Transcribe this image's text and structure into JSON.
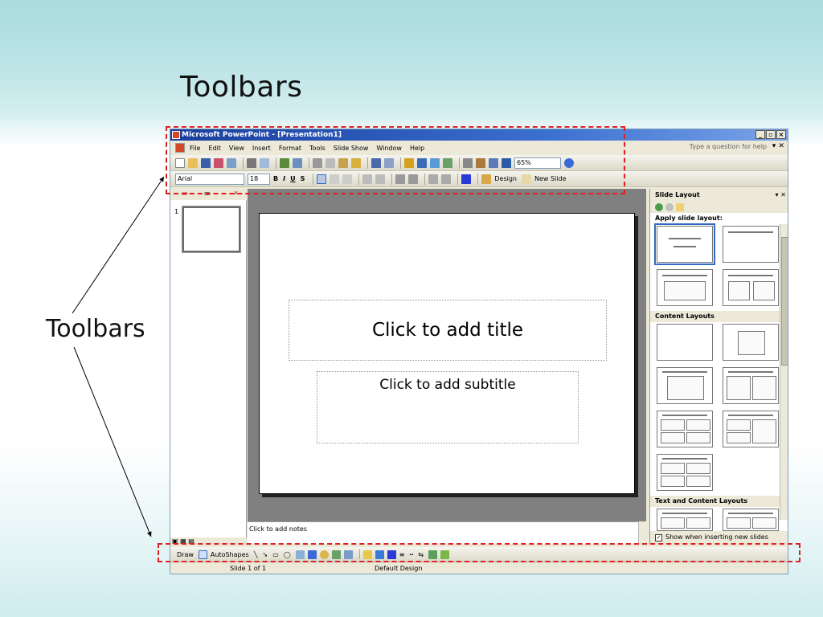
{
  "slide": {
    "title": "Toolbars",
    "side_label": "Toolbars"
  },
  "window": {
    "title": "Microsoft PowerPoint - [Presentation1]",
    "controls": [
      "_",
      "▫",
      "×"
    ],
    "help_placeholder": "Type a question for help"
  },
  "menubar": {
    "items": [
      "File",
      "Edit",
      "View",
      "Insert",
      "Format",
      "Tools",
      "Slide Show",
      "Window",
      "Help"
    ]
  },
  "standard_toolbar": {
    "zoom": "65%"
  },
  "formatting_toolbar": {
    "font": "Arial",
    "size": "18",
    "bold": "B",
    "italic": "I",
    "underline": "U",
    "shadow": "S",
    "design": "Design",
    "new_slide": "New Slide"
  },
  "thumbnails": {
    "slide_number": "1"
  },
  "slide_canvas": {
    "title_placeholder": "Click to add title",
    "subtitle_placeholder": "Click to add subtitle"
  },
  "notes": {
    "placeholder": "Click to add notes"
  },
  "task_pane": {
    "title": "Slide Layout",
    "apply_label": "Apply slide layout:",
    "section_content": "Content Layouts",
    "section_text_content": "Text and Content Layouts",
    "show_when_inserting": "Show when inserting new slides"
  },
  "drawing_toolbar": {
    "draw": "Draw",
    "autoshapes": "AutoShapes"
  },
  "statusbar": {
    "slide_of": "Slide 1 of 1",
    "design": "Default Design"
  },
  "colors": {
    "highlight": "#e02020",
    "titlebar": "#1a3e9b"
  }
}
